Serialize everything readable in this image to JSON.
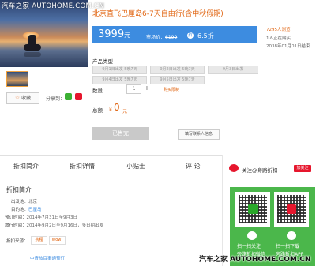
{
  "watermark_top": "汽车之家 AUTOHOME.COM.CN",
  "watermark_bottom": "汽车之家 AUTOHOME.COM.CN",
  "product": {
    "title": "北京直飞巴厘岛6-7天自由行(含中秋假期)",
    "price": "3999",
    "price_unit": "元",
    "market_price_label": "市场价：",
    "market_price": "6199",
    "discount_icon": "折",
    "discount": "6.5折",
    "side_notes": [
      "7295人浏览",
      "1人正在购买",
      "2038年01月01日结束"
    ]
  },
  "product_type": {
    "label": "产品类型",
    "options": [
      "9月1日出发 5晚7天",
      "9月2日出发 5晚7天",
      "9月3日出发",
      "9月4日出发 5晚7天",
      "9月5日出发 5晚7天"
    ]
  },
  "quantity": {
    "label": "数量",
    "minus": "−",
    "value": "1",
    "plus": "+",
    "note": "购买限制"
  },
  "total": {
    "label": "总额",
    "currency": "¥",
    "value": "0",
    "unit": "元"
  },
  "actions": {
    "sold_out": "已售完",
    "contact": "填写联系人信息"
  },
  "collect": {
    "star": "☆",
    "label": "收藏"
  },
  "share_label": "分享到：",
  "tabs": [
    "折扣简介",
    "折扣详情",
    "小贴士",
    "评 论"
  ],
  "section": {
    "title": "折扣简介",
    "rows": [
      {
        "k": "出发地：",
        "v": "北京"
      },
      {
        "k": "目的地：",
        "v": "巴厘岛"
      },
      {
        "k": "预订时间：",
        "v": "2014年7月31日至9月3日"
      },
      {
        "k": "旅行时间：",
        "v": "2014年9月2日至9月16日，多日期出发"
      }
    ],
    "pay_label": "折扣来源：",
    "pay_chips": [
      "携程",
      "Wow!"
    ],
    "more_link": "中青旅百事通预订"
  },
  "follow": {
    "text": "关注@旁路折扣",
    "button": "加关注"
  },
  "qr": {
    "left_lines": [
      "扫一扫关注",
      "旁路折扣微信"
    ],
    "right_lines": [
      "扫一扫下载",
      "旁路折扣APP"
    ]
  },
  "colors": {
    "accent": "#3d8ce0",
    "orange": "#e0620d",
    "green": "#4bb74b",
    "red": "#e6162d"
  }
}
